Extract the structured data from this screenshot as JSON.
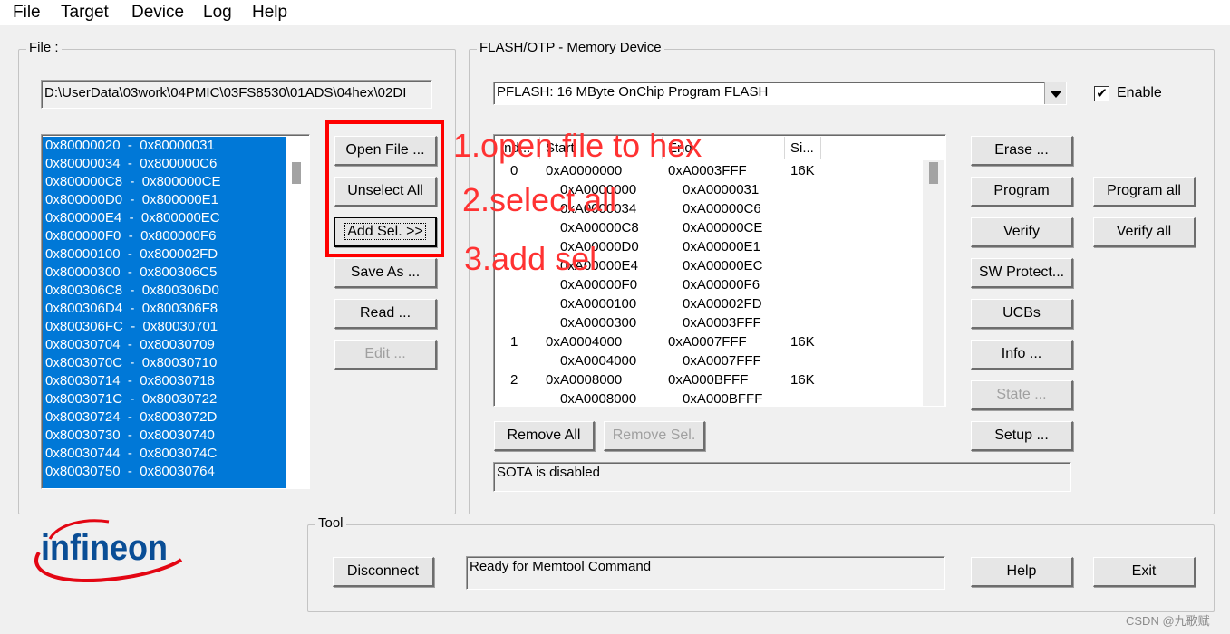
{
  "menu": [
    "File",
    "Target",
    "Device",
    "Log",
    "Help"
  ],
  "file_group": {
    "label": "File :",
    "path": "D:\\UserData\\03work\\04PMIC\\03FS8530\\01ADS\\04hex\\02DI",
    "ranges": [
      "0x80000020  -  0x80000031",
      "0x80000034  -  0x800000C6",
      "0x800000C8  -  0x800000CE",
      "0x800000D0  -  0x800000E1",
      "0x800000E4  -  0x800000EC",
      "0x800000F0  -  0x800000F6",
      "0x80000100  -  0x800002FD",
      "0x80000300  -  0x800306C5",
      "0x800306C8  -  0x800306D0",
      "0x800306D4  -  0x800306F8",
      "0x800306FC  -  0x80030701",
      "0x80030704  -  0x80030709",
      "0x8003070C  -  0x80030710",
      "0x80030714  -  0x80030718",
      "0x8003071C  -  0x80030722",
      "0x80030724  -  0x8003072D",
      "0x80030730  -  0x80030740",
      "0x80030744  -  0x8003074C",
      "0x80030750  -  0x80030764"
    ],
    "buttons": {
      "open_file": "Open File ...",
      "unselect_all": "Unselect All",
      "add_sel": "Add Sel. >>",
      "save_as": "Save As ...",
      "read": "Read ...",
      "edit": "Edit ..."
    }
  },
  "flash_group": {
    "label": "FLASH/OTP - Memory Device",
    "device": "PFLASH: 16 MByte OnChip Program FLASH",
    "enable_label": "Enable",
    "enable_checked": true,
    "table_headers": [
      "Ind...",
      "Start",
      "End",
      "Si..."
    ],
    "table_rows": [
      {
        "index": "0",
        "start": "0xA0000000",
        "end": "0xA0003FFF",
        "size": "16K",
        "sub": false
      },
      {
        "index": "",
        "start": "0xA0000000",
        "end": "0xA0000031",
        "size": "",
        "sub": true
      },
      {
        "index": "",
        "start": "0xA0000034",
        "end": "0xA00000C6",
        "size": "",
        "sub": true
      },
      {
        "index": "",
        "start": "0xA00000C8",
        "end": "0xA00000CE",
        "size": "",
        "sub": true
      },
      {
        "index": "",
        "start": "0xA00000D0",
        "end": "0xA00000E1",
        "size": "",
        "sub": true
      },
      {
        "index": "",
        "start": "0xA00000E4",
        "end": "0xA00000EC",
        "size": "",
        "sub": true
      },
      {
        "index": "",
        "start": "0xA00000F0",
        "end": "0xA00000F6",
        "size": "",
        "sub": true
      },
      {
        "index": "",
        "start": "0xA0000100",
        "end": "0xA00002FD",
        "size": "",
        "sub": true
      },
      {
        "index": "",
        "start": "0xA0000300",
        "end": "0xA0003FFF",
        "size": "",
        "sub": true
      },
      {
        "index": "1",
        "start": "0xA0004000",
        "end": "0xA0007FFF",
        "size": "16K",
        "sub": false
      },
      {
        "index": "",
        "start": "0xA0004000",
        "end": "0xA0007FFF",
        "size": "",
        "sub": true
      },
      {
        "index": "2",
        "start": "0xA0008000",
        "end": "0xA000BFFF",
        "size": "16K",
        "sub": false
      },
      {
        "index": "",
        "start": "0xA0008000",
        "end": "0xA000BFFF",
        "size": "",
        "sub": true
      }
    ],
    "buttons": {
      "remove_all": "Remove All",
      "remove_sel": "Remove Sel.",
      "erase": "Erase ...",
      "program": "Program",
      "verify": "Verify",
      "sw_protect": "SW Protect...",
      "ucbs": "UCBs",
      "info": "Info ...",
      "state": "State ...",
      "setup": "Setup ...",
      "program_all": "Program all",
      "verify_all": "Verify all"
    },
    "sota_status": "SOTA is disabled"
  },
  "tool_group": {
    "label": "Tool",
    "disconnect": "Disconnect",
    "status": "Ready for Memtool Command",
    "help": "Help",
    "exit": "Exit"
  },
  "logo_text": "infineon",
  "annotations": [
    "1.open file to hex",
    "2.select all",
    "3.add sel"
  ],
  "watermark": "CSDN @九歌赋",
  "colors": {
    "selection": "#0078d7",
    "annotation": "#ff0000",
    "logo_text": "#0a4e96",
    "logo_swoosh": "#e30613"
  }
}
